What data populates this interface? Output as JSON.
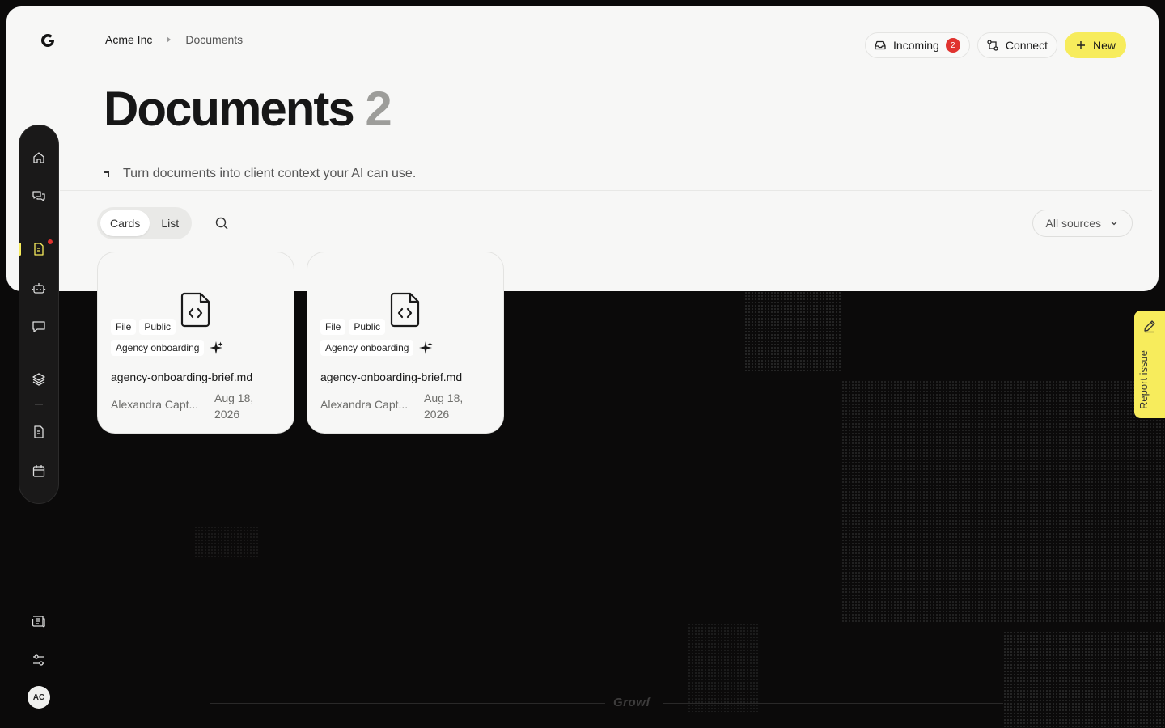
{
  "breadcrumb": {
    "org": "Acme Inc",
    "page": "Documents"
  },
  "top_actions": {
    "incoming_label": "Incoming",
    "incoming_count": "2",
    "connect_label": "Connect",
    "new_label": "New"
  },
  "page": {
    "title": "Documents",
    "count": "2",
    "subtitle": "Turn documents into client context your AI can use."
  },
  "view_toggle": {
    "cards_label": "Cards",
    "list_label": "List",
    "active": "Cards"
  },
  "filter": {
    "sources_label": "All sources"
  },
  "documents": [
    {
      "tag_type": "File",
      "tag_visibility": "Public",
      "collection": "Agency onboarding",
      "filename": "agency-onboarding-brief.md",
      "author": "Alexandra Capt...",
      "date": "Aug 18, 2026"
    },
    {
      "tag_type": "File",
      "tag_visibility": "Public",
      "collection": "Agency onboarding",
      "filename": "agency-onboarding-brief.md",
      "author": "Alexandra Capt...",
      "date": "Aug 18, 2026"
    }
  ],
  "sidebar": {
    "items": [
      "home-icon",
      "conversations-icon",
      "documents-icon",
      "bot-icon",
      "chat-icon",
      "layers-icon",
      "file-icon",
      "calendar-icon"
    ],
    "active": "documents-icon"
  },
  "user": {
    "initials": "AC"
  },
  "footer": {
    "brand": "Growf"
  },
  "report": {
    "label": "Report issue"
  },
  "colors": {
    "accent": "#f7ec5c",
    "badge": "#e0332f",
    "panel": "#f7f7f6",
    "background": "#0b0a0a"
  }
}
